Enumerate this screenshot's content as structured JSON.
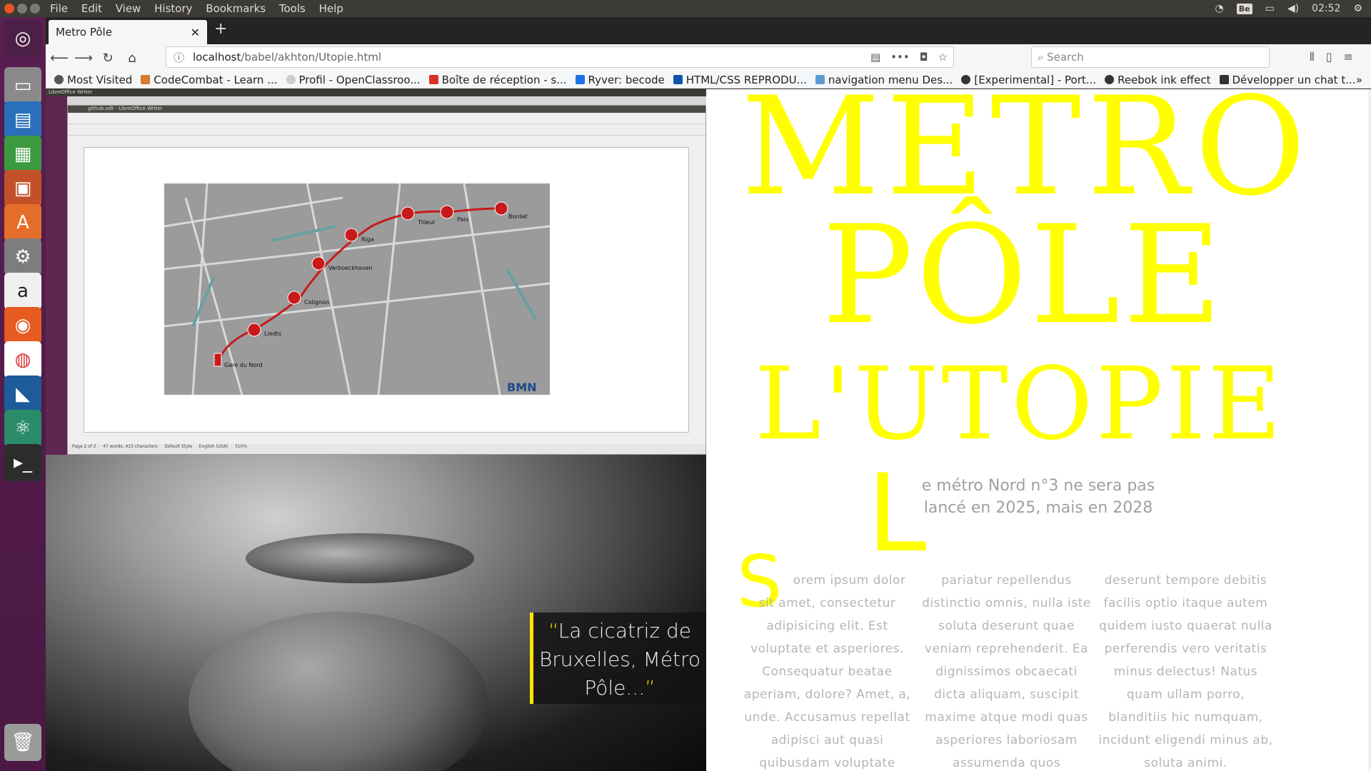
{
  "system_menu": {
    "items": [
      "File",
      "Edit",
      "View",
      "History",
      "Bookmarks",
      "Tools",
      "Help"
    ],
    "keyboard_layout": "Be",
    "clock": "02:52"
  },
  "browser": {
    "tab_title": "Metro Pôle",
    "url_host": "localhost",
    "url_path": "/babel/akhton/Utopie.html",
    "search_placeholder": "Search",
    "bookmarks": [
      {
        "label": "Most Visited",
        "color": "#555555"
      },
      {
        "label": "CodeCombat - Learn ...",
        "color": "#d67c2a"
      },
      {
        "label": "Profil - OpenClassroo...",
        "color": "#cccccc"
      },
      {
        "label": "Boîte de réception - s...",
        "color": "#d93025"
      },
      {
        "label": "Ryver: becode",
        "color": "#1a73e8"
      },
      {
        "label": "HTML/CSS REPRODU...",
        "color": "#1155aa"
      },
      {
        "label": "navigation menu Des...",
        "color": "#5a9bd5"
      },
      {
        "label": "[Experimental] - Port...",
        "color": "#333333"
      },
      {
        "label": "Reebok ink effect",
        "color": "#333333"
      },
      {
        "label": "Développer un chat t...",
        "color": "#333333"
      }
    ]
  },
  "libreoffice": {
    "window_title": "LibreOffice Writer",
    "doc_title": "github.odt - LibreOffice Writer",
    "status_page": "Page 2 of 2",
    "status_words": "47 words, 415 characters",
    "status_style": "Default Style",
    "status_lang": "English (USA)",
    "status_zoom": "310%",
    "map_brand": "BMN",
    "stations": [
      "Gare du Nord",
      "Liedts",
      "Colignon",
      "Verboeckhoven",
      "Riga",
      "Tilleul",
      "Paix",
      "Bordet"
    ]
  },
  "quote": {
    "open": "“",
    "text": "La cicatriz de Bruxelles, Métro Pôle...",
    "close": "”"
  },
  "hero": {
    "line1": "METRO",
    "line2": "PÔLE",
    "line3": "L'UTOPIE",
    "dropcap": "L",
    "subtitle": "e métro Nord n°3 ne sera pas lancé en 2025, mais en 2028"
  },
  "body": {
    "dropcap": "S",
    "col1": "orem ipsum dolor sit amet, consectetur adipisicing elit. Est voluptate et asperiores. Consequatur beatae aperiam, dolore? Amet, a, unde. Accusamus repellat adipisci aut quasi quibusdam voluptate",
    "col2": "pariatur repellendus distinctio omnis, nulla iste soluta deserunt quae veniam reprehenderit. Ea dignissimos obcaecati dicta aliquam, suscipit maxime atque modi quas asperiores laboriosam assumenda quos",
    "col3": "deserunt tempore debitis facilis optio itaque autem quidem iusto quaerat nulla perferendis vero veritatis minus delectus! Natus quam ullam porro, blanditiis hic numquam, incidunt eligendi minus ab, soluta animi."
  },
  "colors": {
    "accent_yellow": "#ffff00",
    "launcher_purple": "#5a1f52",
    "text_grey": "#b5b5b5"
  }
}
